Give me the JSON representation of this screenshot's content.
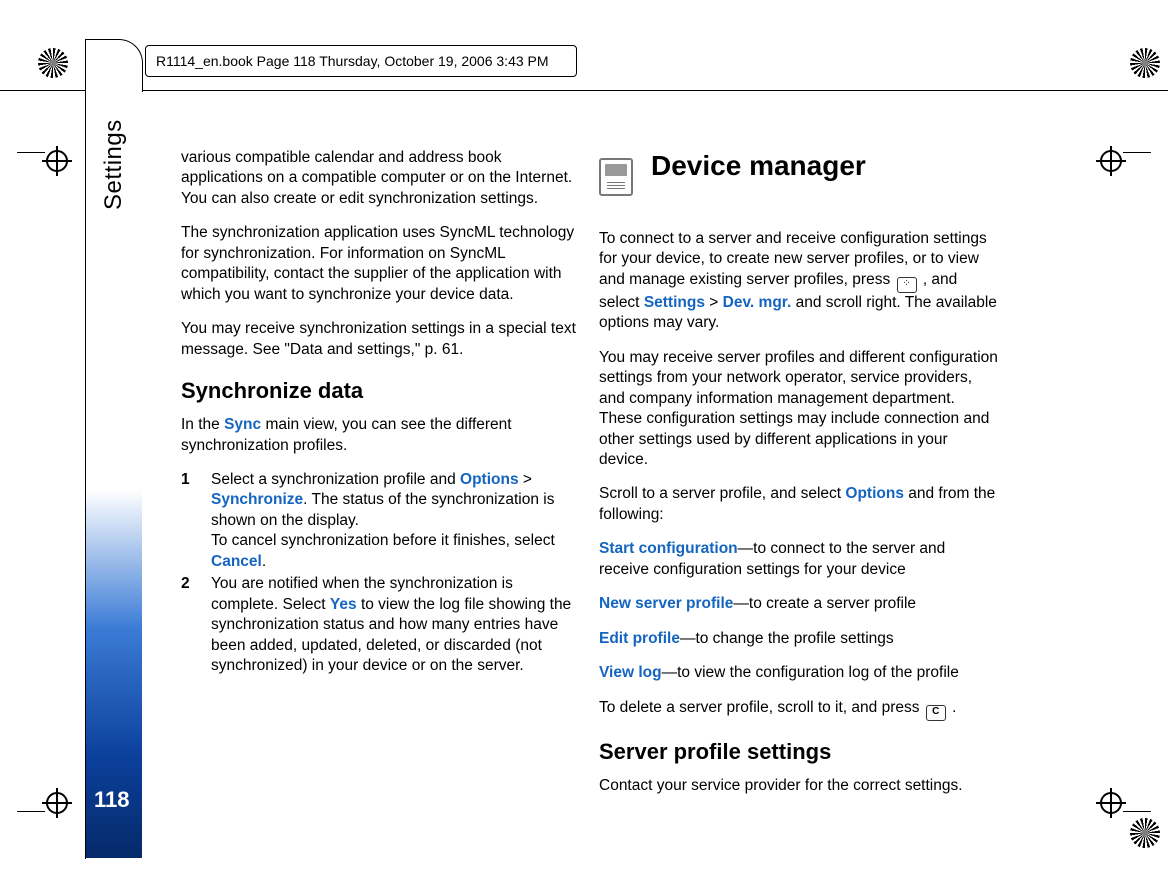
{
  "header": "R1114_en.book  Page 118  Thursday, October 19, 2006  3:43 PM",
  "section_label": "Settings",
  "page_number": "118",
  "col1": {
    "p1": "various compatible calendar and address book applications on a compatible computer or on the Internet. You can also create or edit synchronization settings.",
    "p2": "The synchronization application uses SyncML technology for synchronization. For information on SyncML compatibility, contact the supplier of the application with which you want to synchronize your device data.",
    "p3": "You may receive synchronization settings in a special text message. See \"Data and settings,\" p. 61.",
    "h_sync": "Synchronize data",
    "p4a": "In the ",
    "sync_word": "Sync",
    "p4b": " main view, you can see the different synchronization profiles.",
    "step1_num": "1",
    "step1a": "Select a synchronization profile and ",
    "options_word": "Options",
    "gt": " > ",
    "synchronize_word": "Synchronize",
    "step1b": ". The status of the synchronization is shown on the display.",
    "step1c": "To cancel synchronization before it finishes, select ",
    "cancel_word": "Cancel",
    "step1d": ".",
    "step2_num": "2",
    "step2a": "You are notified when the synchronization is complete. Select ",
    "yes_word": "Yes",
    "step2b": " to view the log file showing the synchronization status and how many entries have been added, updated, deleted, or discarded (not synchronized) in your device or on the server."
  },
  "col2": {
    "h_dev": "Device manager",
    "p1a": "To connect to a server and receive configuration settings for your device, to create new server profiles, or to view and manage existing server profiles, press ",
    "p1b": " , and select ",
    "settings_word": "Settings",
    "gt": " > ",
    "devmgr_word": "Dev. mgr.",
    "p1c": " and scroll right. The available options may vary.",
    "p2": "You may receive server profiles and different configuration settings from your network operator, service providers, and company information management department. These configuration settings may include connection and other settings used by different applications in your device.",
    "p3a": "Scroll to a server profile, and select ",
    "options_word": "Options",
    "p3b": " and from the following:",
    "opt1_label": "Start configuration",
    "opt1_desc": "—to connect to the server and receive configuration settings for your device",
    "opt2_label": "New server profile",
    "opt2_desc": "—to create a server profile",
    "opt3_label": "Edit profile",
    "opt3_desc": "—to change the profile settings",
    "opt4_label": "View log",
    "opt4_desc": "—to view the configuration log of the profile",
    "p_delete_a": "To delete a server profile, scroll to it, and press ",
    "c_key": "C",
    "p_delete_b": " .",
    "h_srv": "Server profile settings",
    "p_srv": "Contact your service provider for the correct settings."
  }
}
